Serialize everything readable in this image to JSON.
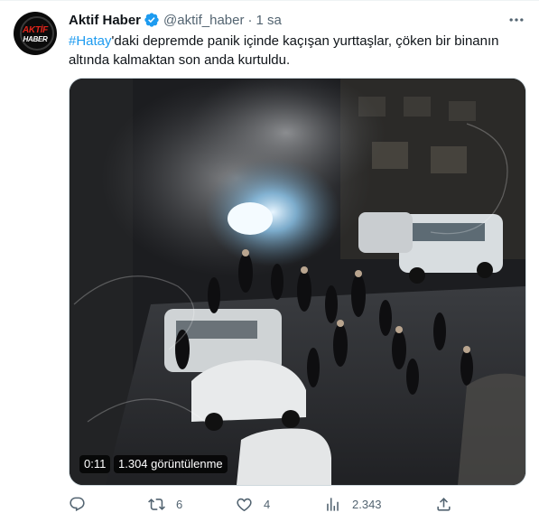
{
  "tweet": {
    "author": {
      "display_name": "Aktif Haber",
      "handle": "@aktif_haber",
      "verified": true,
      "avatar_logo_top": "AKTİF",
      "avatar_logo_bottom": "HABER"
    },
    "separator": "·",
    "time": "1 sa",
    "text": {
      "hashtag": "#Hatay",
      "body": "'daki depremde panik içinde kaçışan yurttaşlar, çöken bir binanın altında kalmaktan son anda kurtuldu."
    },
    "media": {
      "duration": "0:11",
      "views": "1.304 görüntülenme"
    },
    "actions": {
      "reply_count": "",
      "retweet_count": "6",
      "like_count": "4",
      "views_count": "2.343"
    }
  },
  "colors": {
    "accent": "#1d9bf0",
    "text": "#0f1419",
    "secondary": "#536471",
    "border": "#cfd9de",
    "avatar_red": "#e0251b"
  },
  "icons": {
    "verified": "verified-badge-icon",
    "more": "more-options-icon",
    "reply": "reply-icon",
    "retweet": "retweet-icon",
    "like": "like-icon",
    "views": "views-icon",
    "share": "share-icon"
  }
}
